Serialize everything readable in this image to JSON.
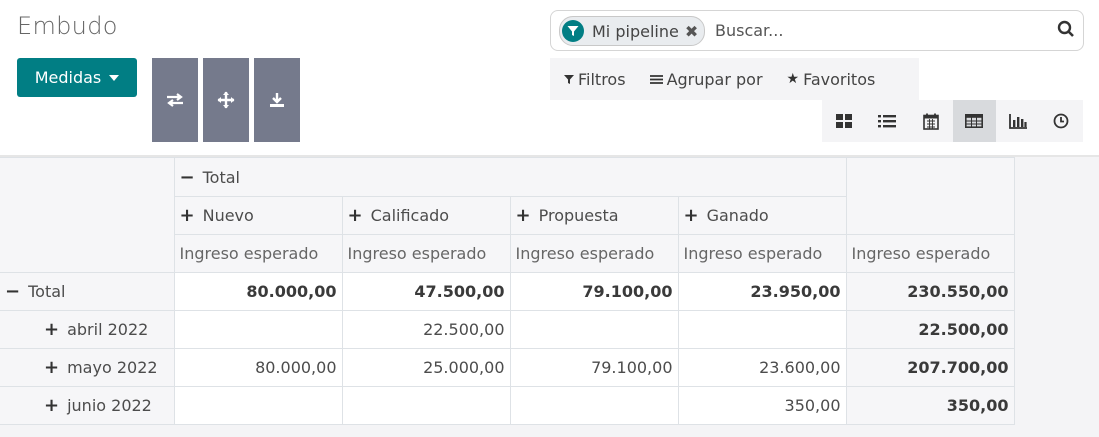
{
  "page": {
    "title": "Embudo"
  },
  "toolbar": {
    "measures_label": "Medidas"
  },
  "search": {
    "facet_label": "Mi pipeline",
    "placeholder": "Buscar..."
  },
  "filters": {
    "filters_label": "Filtros",
    "group_by_label": "Agrupar por",
    "favorites_label": "Favoritos"
  },
  "views": [
    "kanban",
    "list",
    "calendar",
    "pivot",
    "graph",
    "activity"
  ],
  "active_view": "pivot",
  "pivot": {
    "col_group_total": "Total",
    "stages": [
      "Nuevo",
      "Calificado",
      "Propuesta",
      "Ganado"
    ],
    "measure": "Ingreso esperado",
    "total_row": {
      "label": "Total",
      "values": [
        "80.000,00",
        "47.500,00",
        "79.100,00",
        "23.950,00",
        "230.550,00"
      ]
    },
    "rows": [
      {
        "label": "abril 2022",
        "values": [
          "",
          "22.500,00",
          "",
          "",
          "22.500,00"
        ]
      },
      {
        "label": "mayo 2022",
        "values": [
          "80.000,00",
          "25.000,00",
          "79.100,00",
          "23.600,00",
          "207.700,00"
        ]
      },
      {
        "label": "junio 2022",
        "values": [
          "",
          "",
          "",
          "350,00",
          "350,00"
        ]
      }
    ]
  },
  "colors": {
    "primary": "#017e84",
    "tool_button": "#757a8c"
  }
}
